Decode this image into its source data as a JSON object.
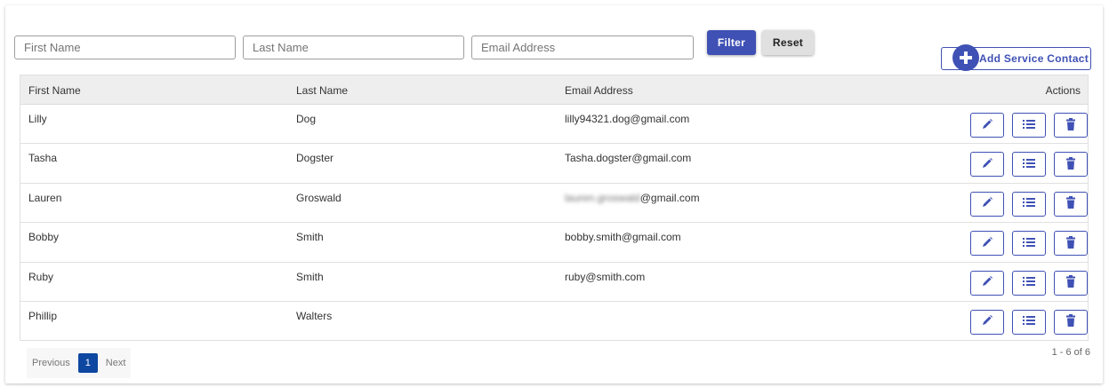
{
  "filters": {
    "first_name_placeholder": "First Name",
    "last_name_placeholder": "Last Name",
    "email_placeholder": "Email Address",
    "filter_label": "Filter",
    "reset_label": "Reset"
  },
  "add_button": {
    "label": "Add Service Contact"
  },
  "table": {
    "headers": {
      "first_name": "First Name",
      "last_name": "Last Name",
      "email": "Email Address",
      "actions": "Actions"
    },
    "rows": [
      {
        "first": "Lilly",
        "last": "Dog",
        "email": "lilly94321.dog@gmail.com"
      },
      {
        "first": "Tasha",
        "last": "Dogster",
        "email": "Tasha.dogster@gmail.com"
      },
      {
        "first": "Lauren",
        "last": "Groswald",
        "email_redacted": "lauren.groswald",
        "email_suffix": "@gmail.com"
      },
      {
        "first": "Bobby",
        "last": "Smith",
        "email": "bobby.smith@gmail.com"
      },
      {
        "first": "Ruby",
        "last": "Smith",
        "email": "ruby@smith.com"
      },
      {
        "first": "Phillip",
        "last": "Walters",
        "email": ""
      }
    ]
  },
  "pagination": {
    "previous": "Previous",
    "current_page": "1",
    "next": "Next",
    "range": "1 - 6 of 6"
  },
  "colors": {
    "primary": "#3f51b5",
    "page_active": "#0d47a1",
    "header_bg": "#eeeeee"
  },
  "icons": {
    "add": "plus-circle-icon",
    "edit": "pencil-icon",
    "details": "list-icon",
    "delete": "trash-icon"
  }
}
